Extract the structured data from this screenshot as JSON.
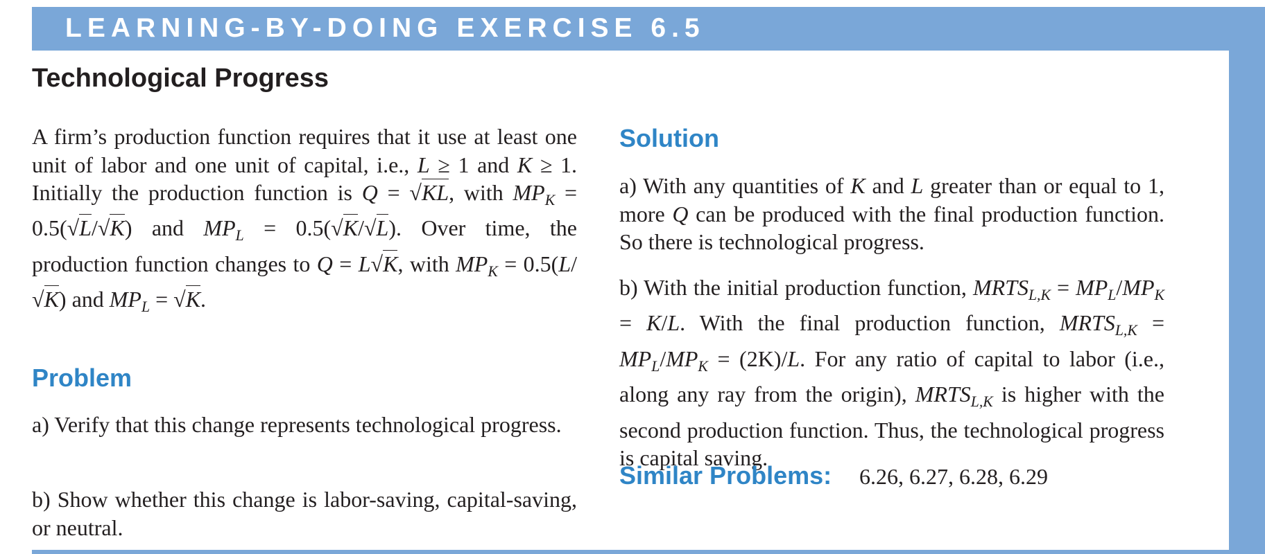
{
  "banner": "LEARNING-BY-DOING EXERCISE 6.5",
  "title": "Technological Progress",
  "problem_heading": "Problem",
  "solution_heading": "Solution",
  "intro": {
    "line1": "A firm’s production function requires that it use at least one unit of labor and one unit of capital, i.e.,",
    "L": "L",
    "K": "K",
    "geq_one": " ≥ 1",
    "and": " and ",
    "initially": " Initially the production function is",
    "Q": "Q",
    "eq": " = ",
    "KL": "KL",
    "with": ", with ",
    "MP": "MP",
    "half_open": "0.5(",
    "close": ")",
    "slash": "/",
    "over_time": ". Over time, the production function changes to ",
    "period": "."
  },
  "problem": {
    "a": "a) Verify that this change represents technological progress.",
    "b": "b) Show whether this change is labor-saving, capital-saving, or neutral."
  },
  "solution": {
    "a_1": "a) With any quantities of ",
    "a_2": " and ",
    "a_3": " greater than or equal to 1, more ",
    "a_4": " can be produced with the final production function. So there is technological progress.",
    "b_1": "b) With the initial production function, ",
    "MRTS": "MRTS",
    "LK": "L,K",
    "b_2": ". With the final production function, ",
    "twoK": "(2K)",
    "b_3": ". For any ratio of capi­tal to labor (i.e., along any ray from the origin), ",
    "b_4": " is higher with the second production function. Thus, the technological progress is capital saving."
  },
  "similar": {
    "label": "Similar Problems:",
    "list": "6.26, 6.27, 6.28, 6.29"
  },
  "colors": {
    "frame": "#7aa7d8",
    "heading_blue": "#2f85c6",
    "text": "#231f20"
  }
}
